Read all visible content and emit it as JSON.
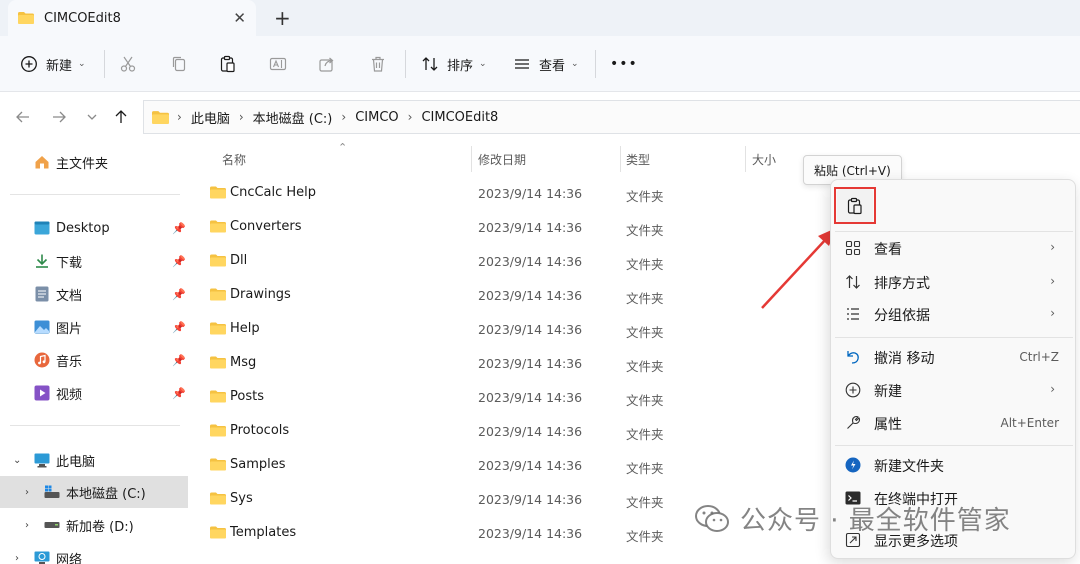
{
  "window": {
    "tab_title": "CIMCOEdit8",
    "close_symbol": "✕",
    "new_tab_symbol": "+"
  },
  "toolbar": {
    "new_label": "新建",
    "sort_label": "排序",
    "view_label": "查看",
    "more_label": "•••",
    "icons": [
      "new-icon",
      "cut-icon",
      "copy-icon",
      "paste-icon",
      "rename-icon",
      "share-icon",
      "delete-icon",
      "sort-icon",
      "view-icon",
      "more-icon"
    ]
  },
  "address": {
    "crumbs": [
      "此电脑",
      "本地磁盘 (C:)",
      "CIMCO",
      "CIMCOEdit8"
    ]
  },
  "sidebar": {
    "home": "主文件夹",
    "quick": [
      {
        "label": "Desktop",
        "icon": "desktop-icon"
      },
      {
        "label": "下载",
        "icon": "download-icon"
      },
      {
        "label": "文档",
        "icon": "document-icon"
      },
      {
        "label": "图片",
        "icon": "picture-icon"
      },
      {
        "label": "音乐",
        "icon": "music-icon"
      },
      {
        "label": "视频",
        "icon": "video-icon"
      }
    ],
    "this_pc": "此电脑",
    "drive_c": "本地磁盘 (C:)",
    "drive_d": "新加卷 (D:)",
    "network": "网络"
  },
  "columns": {
    "name": "名称",
    "date": "修改日期",
    "type": "类型",
    "size": "大小"
  },
  "files": [
    {
      "name": "CncCalc Help",
      "date": "2023/9/14 14:36",
      "type": "文件夹"
    },
    {
      "name": "Converters",
      "date": "2023/9/14 14:36",
      "type": "文件夹"
    },
    {
      "name": "Dll",
      "date": "2023/9/14 14:36",
      "type": "文件夹"
    },
    {
      "name": "Drawings",
      "date": "2023/9/14 14:36",
      "type": "文件夹"
    },
    {
      "name": "Help",
      "date": "2023/9/14 14:36",
      "type": "文件夹"
    },
    {
      "name": "Msg",
      "date": "2023/9/14 14:36",
      "type": "文件夹"
    },
    {
      "name": "Posts",
      "date": "2023/9/14 14:36",
      "type": "文件夹"
    },
    {
      "name": "Protocols",
      "date": "2023/9/14 14:36",
      "type": "文件夹"
    },
    {
      "name": "Samples",
      "date": "2023/9/14 14:36",
      "type": "文件夹"
    },
    {
      "name": "Sys",
      "date": "2023/9/14 14:36",
      "type": "文件夹"
    },
    {
      "name": "Templates",
      "date": "2023/9/14 14:36",
      "type": "文件夹"
    }
  ],
  "tooltip": "粘贴 (Ctrl+V)",
  "context_menu": {
    "items": [
      {
        "label": "查看",
        "shortcut": "",
        "submenu": true,
        "icon": "view-grid-icon"
      },
      {
        "label": "排序方式",
        "shortcut": "",
        "submenu": true,
        "icon": "sort-icon"
      },
      {
        "label": "分组依据",
        "shortcut": "",
        "submenu": true,
        "icon": "group-icon"
      },
      {
        "label": "撤消 移动",
        "shortcut": "Ctrl+Z",
        "submenu": false,
        "icon": "undo-icon"
      },
      {
        "label": "新建",
        "shortcut": "",
        "submenu": true,
        "icon": "new-icon"
      },
      {
        "label": "属性",
        "shortcut": "Alt+Enter",
        "submenu": false,
        "icon": "properties-icon"
      },
      {
        "label": "新建文件夹",
        "shortcut": "",
        "submenu": false,
        "icon": "new-folder-icon"
      },
      {
        "label": "在终端中打开",
        "shortcut": "",
        "submenu": false,
        "icon": "terminal-icon"
      },
      {
        "label": "显示更多选项",
        "shortcut": "",
        "submenu": false,
        "icon": "more-options-icon"
      }
    ]
  },
  "watermark": "公众号 · 最全软件管家",
  "colors": {
    "accent": "#0067c0",
    "folder": "#f5c242",
    "annotation_red": "#e53935"
  }
}
